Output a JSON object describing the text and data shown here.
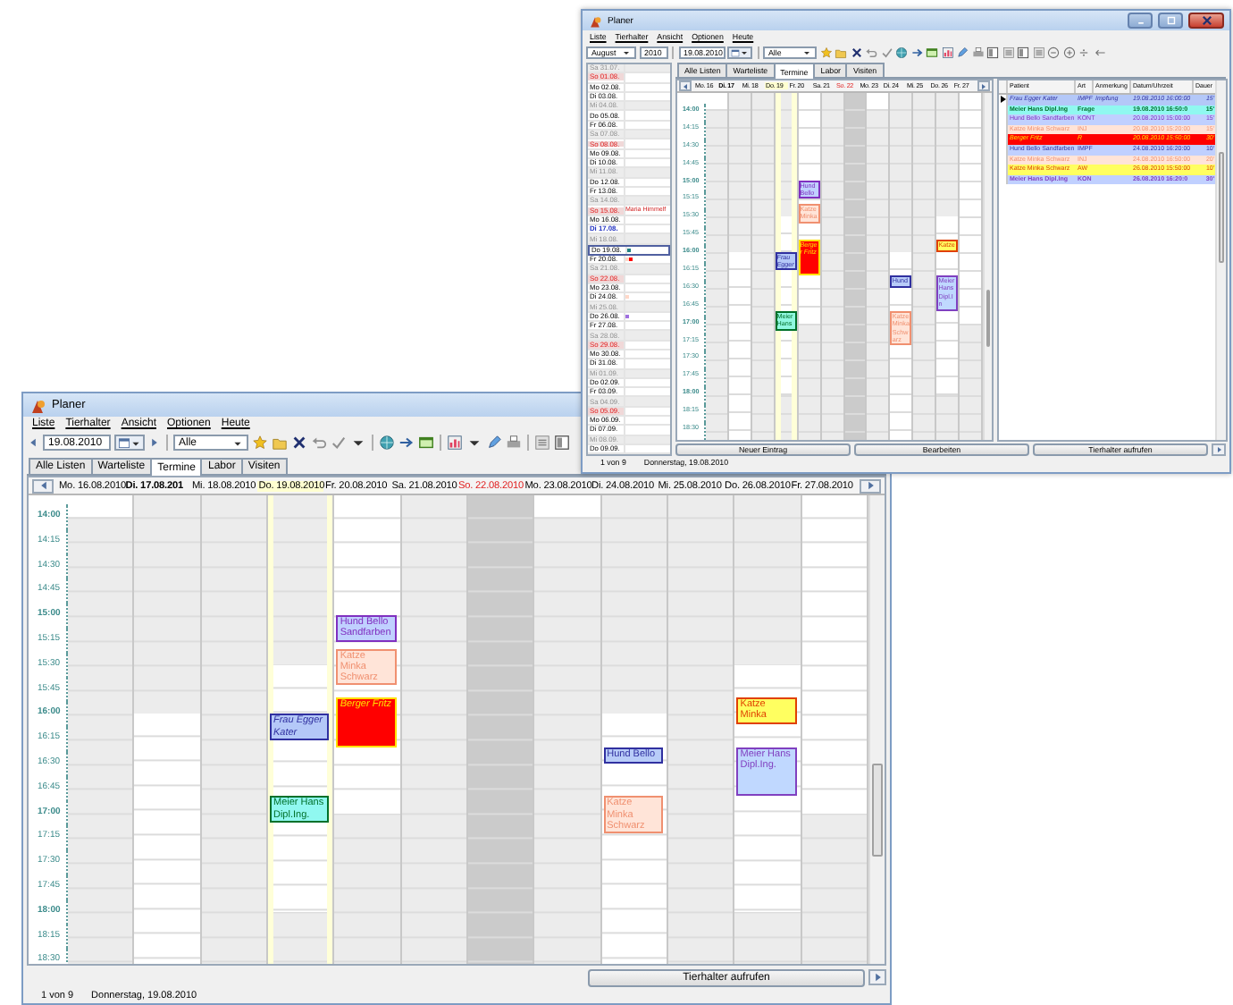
{
  "back_window": {
    "title": "Planer",
    "menu": [
      "Liste",
      "Tierhalter",
      "Ansicht",
      "Optionen",
      "Heute"
    ],
    "toolbar": {
      "month": "August",
      "year": "2010",
      "date": "19.08.2010",
      "filter": "Alle"
    },
    "date_list": [
      {
        "label": "Sa 31.07.",
        "kind": "closed",
        "selected": false
      },
      {
        "label": "So 01.08.",
        "kind": "sunday",
        "selected": false
      },
      {
        "label": "Mo 02.08.",
        "kind": "workday",
        "selected": false
      },
      {
        "label": "Di 03.08.",
        "kind": "workday",
        "selected": false
      },
      {
        "label": "Mi 04.08.",
        "kind": "closed",
        "selected": false
      },
      {
        "label": "Do 05.08.",
        "kind": "workday",
        "selected": false
      },
      {
        "label": "Fr 06.08.",
        "kind": "workday",
        "selected": false
      },
      {
        "label": "Sa 07.08.",
        "kind": "closed",
        "selected": false
      },
      {
        "label": "So 08.08.",
        "kind": "sunday",
        "selected": false
      },
      {
        "label": "Mo 09.08.",
        "kind": "workday",
        "selected": false
      },
      {
        "label": "Di 10.08.",
        "kind": "workday",
        "selected": false
      },
      {
        "label": "Mi 11.08.",
        "kind": "closed",
        "selected": false
      },
      {
        "label": "Do 12.08.",
        "kind": "workday",
        "selected": false
      },
      {
        "label": "Fr 13.08.",
        "kind": "workday",
        "selected": false
      },
      {
        "label": "Sa 14.08.",
        "kind": "closed",
        "selected": false
      },
      {
        "label": "So 15.08.",
        "kind": "sunday",
        "selected": false,
        "note": "Maria Himmelf"
      },
      {
        "label": "Mo 16.08.",
        "kind": "workday",
        "selected": false
      },
      {
        "label": "Di 17.08.",
        "kind": "today",
        "selected": false
      },
      {
        "label": "Mi 18.08.",
        "kind": "closed",
        "selected": false
      },
      {
        "label": "Do 19.08.",
        "kind": "workday",
        "selected": true,
        "marks": [
          {
            "color": "#208080"
          }
        ]
      },
      {
        "label": "Fr 20.08.",
        "kind": "workday",
        "selected": false,
        "marks": [
          {
            "color": "#ffd8c8"
          },
          {
            "color": "#ff0000"
          }
        ]
      },
      {
        "label": "Sa 21.08.",
        "kind": "closed",
        "selected": false
      },
      {
        "label": "So 22.08.",
        "kind": "sunday",
        "selected": false
      },
      {
        "label": "Mo 23.08.",
        "kind": "workday",
        "selected": false
      },
      {
        "label": "Di 24.08.",
        "kind": "workday",
        "selected": false,
        "marks": [
          {
            "color": "#ffd8c8"
          }
        ]
      },
      {
        "label": "Mi 25.08.",
        "kind": "closed",
        "selected": false
      },
      {
        "label": "Do 26.08.",
        "kind": "workday",
        "selected": false,
        "marks": [
          {
            "color": "#a070e0"
          }
        ]
      },
      {
        "label": "Fr 27.08.",
        "kind": "workday",
        "selected": false
      },
      {
        "label": "Sa 28.08.",
        "kind": "closed",
        "selected": false
      },
      {
        "label": "So 29.08.",
        "kind": "sunday",
        "selected": false
      },
      {
        "label": "Mo 30.08.",
        "kind": "workday",
        "selected": false
      },
      {
        "label": "Di 31.08.",
        "kind": "workday",
        "selected": false
      },
      {
        "label": "Mi 01.09.",
        "kind": "closed",
        "selected": false
      },
      {
        "label": "Do 02.09.",
        "kind": "workday",
        "selected": false
      },
      {
        "label": "Fr 03.09.",
        "kind": "workday",
        "selected": false
      },
      {
        "label": "Sa 04.09.",
        "kind": "closed",
        "selected": false
      },
      {
        "label": "So 05.09.",
        "kind": "sunday",
        "selected": false
      },
      {
        "label": "Mo 06.09.",
        "kind": "workday",
        "selected": false
      },
      {
        "label": "Di 07.09.",
        "kind": "workday",
        "selected": false
      },
      {
        "label": "Mi 08.09.",
        "kind": "closed",
        "selected": false
      },
      {
        "label": "Do 09.09.",
        "kind": "workday",
        "selected": false
      }
    ],
    "tabs": [
      {
        "label": "Alle Listen",
        "selected": false
      },
      {
        "label": "Warteliste",
        "selected": false
      },
      {
        "label": "Termine",
        "selected": true
      },
      {
        "label": "Labor",
        "selected": false
      },
      {
        "label": "Visiten",
        "selected": false
      }
    ],
    "calendar": {
      "times": [
        "14:00",
        "14:15",
        "14:30",
        "14:45",
        "15:00",
        "15:15",
        "15:30",
        "15:45",
        "16:00",
        "16:15",
        "16:30",
        "16:45",
        "17:00",
        "17:15",
        "17:30",
        "17:45",
        "18:00",
        "18:15",
        "18:30"
      ],
      "days": [
        {
          "label": "Mo. 16",
          "kind": "open-early",
          "today": false,
          "selected": false
        },
        {
          "label": "Di. 17",
          "kind": "open-late",
          "today": true,
          "selected": false
        },
        {
          "label": "Mi. 18",
          "kind": "closed",
          "today": false,
          "selected": false
        },
        {
          "label": "Do. 19",
          "kind": "open-mid",
          "today": false,
          "selected": true,
          "appointments": [
            {
              "text": "Frau Egger",
              "kind": "impf",
              "color": "#b4c8f8",
              "italic": true,
              "bold": false
            },
            {
              "text": "Meier Hans",
              "kind": "frage",
              "color": "#90f8e0",
              "italic": false,
              "bold": false
            }
          ]
        },
        {
          "label": "Fr. 20",
          "kind": "open-day",
          "today": false,
          "selected": false,
          "appointments": [
            {
              "text": "Hund Bello",
              "kind": "kont",
              "color": "#c0d0ff",
              "italic": false,
              "bold": false
            },
            {
              "text": "Katze Minka",
              "kind": "inj",
              "color": "#ffe4d8",
              "italic": false,
              "bold": false
            },
            {
              "text": "Berger Fritz",
              "kind": "r",
              "color": "#ff0000",
              "italic": true,
              "bold": false
            }
          ]
        },
        {
          "label": "Sa. 21",
          "kind": "closed",
          "today": false,
          "selected": false
        },
        {
          "label": "So. 22",
          "kind": "sunday",
          "today": false,
          "selected": false
        },
        {
          "label": "Mo. 23",
          "kind": "open-early",
          "today": false,
          "selected": false
        },
        {
          "label": "Di. 24",
          "kind": "open-late",
          "today": false,
          "selected": false,
          "appointments": [
            {
              "text": "Hund",
              "kind": "impf",
              "color": "#b8ccf8",
              "italic": false,
              "bold": false
            },
            {
              "text": "Katze Minka Schwarz",
              "kind": "inj",
              "color": "#ffe4d8",
              "italic": false,
              "bold": false
            }
          ]
        },
        {
          "label": "Mi. 25",
          "kind": "closed",
          "today": false,
          "selected": false
        },
        {
          "label": "Do. 26",
          "kind": "open-mid",
          "today": false,
          "selected": false,
          "appointments": [
            {
              "text": "Katze",
              "kind": "aw",
              "color": "#ffff60",
              "italic": false,
              "bold": false
            },
            {
              "text": "Meier Hans Dipl.In",
              "kind": "kon",
              "color": "#c0d8ff",
              "italic": false,
              "bold": false
            }
          ]
        },
        {
          "label": "Fr. 27",
          "kind": "open-day",
          "today": false,
          "selected": false
        }
      ]
    },
    "table": {
      "columns": [
        "Patient",
        "Art",
        "Anmerkung",
        "Datum/Uhrzeit",
        "Dauer"
      ],
      "rows": [
        {
          "selected": true,
          "kind": "impf",
          "color": "#b4c8f8",
          "italic": true,
          "bold": false,
          "patient": "Frau Egger Kater",
          "art": "IMPF",
          "note": "Impfung",
          "datetime": "19.08.2010 16:00:00",
          "duration": "15'"
        },
        {
          "selected": false,
          "kind": "frage",
          "color": "#90f8f0",
          "italic": false,
          "bold": true,
          "patient": "Meier Hans Dipl.Ing",
          "art": "Frage",
          "datetime": "19.08.2010 16:50:0",
          "duration": "15'"
        },
        {
          "selected": false,
          "kind": "kont",
          "color": "#c0d0ff",
          "italic": false,
          "bold": false,
          "patient": "Hund Bello Sandfarben",
          "art": "KONT",
          "datetime": "20.08.2010 15:00:00",
          "duration": "15'"
        },
        {
          "selected": false,
          "kind": "inj",
          "color": "#ffe4d8",
          "italic": false,
          "bold": false,
          "patient": "Katze Minka Schwarz",
          "art": "INJ",
          "datetime": "20.08.2010 15:20:00",
          "duration": "15'"
        },
        {
          "selected": false,
          "kind": "r",
          "color": "#ff0000",
          "italic": true,
          "bold": false,
          "patient": "Berger Fritz",
          "art": "R",
          "datetime": "20.08.2010 15:50:00",
          "duration": "30'"
        },
        {
          "selected": false,
          "kind": "impf",
          "color": "#c0d0ff",
          "italic": false,
          "bold": false,
          "patient": "Hund Bello Sandfarben",
          "art": "IMPF",
          "datetime": "24.08.2010 16:20:00",
          "duration": "10'"
        },
        {
          "selected": false,
          "kind": "inj",
          "color": "#ffe4d8",
          "italic": false,
          "bold": false,
          "patient": "Katze Minka Schwarz",
          "art": "INJ",
          "datetime": "24.08.2010 16:50:00",
          "duration": "20'"
        },
        {
          "selected": false,
          "kind": "aw",
          "color": "#ffff60",
          "italic": false,
          "bold": false,
          "patient": "Katze Minka Schwarz",
          "art": "AW",
          "datetime": "26.08.2010 15:50:00",
          "duration": "10'"
        },
        {
          "selected": false,
          "kind": "kon",
          "color": "#c0d0ff",
          "italic": false,
          "bold": true,
          "patient": "Meier Hans Dipl.Ing",
          "art": "KON",
          "datetime": "26.08.2010 16:20:0",
          "duration": "30'"
        }
      ]
    },
    "buttons": [
      "Neuer Eintrag",
      "Bearbeiten",
      "Tierhalter aufrufen"
    ],
    "status": {
      "count": "1 von 9",
      "date": "Donnerstag, 19.08.2010"
    }
  },
  "front_window": {
    "title": "Planer",
    "menu": [
      "Liste",
      "Tierhalter",
      "Ansicht",
      "Optionen",
      "Heute"
    ],
    "toolbar": {
      "date": "19.08.2010",
      "filter": "Alle"
    },
    "tabs": [
      {
        "label": "Alle Listen",
        "selected": false
      },
      {
        "label": "Warteliste",
        "selected": false
      },
      {
        "label": "Termine",
        "selected": true
      },
      {
        "label": "Labor",
        "selected": false
      },
      {
        "label": "Visiten",
        "selected": false
      }
    ],
    "calendar": {
      "times": [
        "14:00",
        "14:15",
        "14:30",
        "14:45",
        "15:00",
        "15:15",
        "15:30",
        "15:45",
        "16:00",
        "16:15",
        "16:30",
        "16:45",
        "17:00",
        "17:15",
        "17:30",
        "17:45",
        "18:00",
        "18:15",
        "18:30"
      ],
      "days": [
        {
          "label": "Mo. 16.08.2010",
          "kind": "open-early",
          "today": false,
          "selected": false
        },
        {
          "label": "Di. 17.08.201",
          "kind": "open-late",
          "today": true,
          "selected": false
        },
        {
          "label": "Mi. 18.08.2010",
          "kind": "closed",
          "today": false,
          "selected": false
        },
        {
          "label": "Do. 19.08.2010",
          "kind": "open-mid",
          "today": false,
          "selected": true,
          "appointments": [
            {
              "text": "Frau Egger Kater",
              "kind": "impf",
              "color": "#b4c8f8",
              "italic": true,
              "bold": false
            },
            {
              "text": "Meier Hans Dipl.Ing.",
              "kind": "frage",
              "color": "#90f8f0",
              "italic": false,
              "bold": false
            }
          ]
        },
        {
          "label": "Fr. 20.08.2010",
          "kind": "open-day",
          "today": false,
          "selected": false,
          "appointments": [
            {
              "text": "Hund Bello Sandfarben",
              "kind": "kont",
              "color": "#c0d0ff",
              "italic": false,
              "bold": false
            },
            {
              "text": "Katze Minka Schwarz",
              "kind": "inj",
              "color": "#ffe4d8",
              "italic": false,
              "bold": false
            },
            {
              "text": "Berger Fritz",
              "kind": "r",
              "color": "#ff0000",
              "italic": true,
              "bold": false
            }
          ]
        },
        {
          "label": "Sa. 21.08.2010",
          "kind": "closed",
          "today": false,
          "selected": false
        },
        {
          "label": "So. 22.08.2010",
          "kind": "sunday",
          "today": false,
          "selected": false
        },
        {
          "label": "Mo. 23.08.2010",
          "kind": "open-early",
          "today": false,
          "selected": false
        },
        {
          "label": "Di. 24.08.2010",
          "kind": "open-late",
          "today": false,
          "selected": false,
          "appointments": [
            {
              "text": "Hund Bello",
              "kind": "impf",
              "color": "#b8ccf8",
              "italic": false,
              "bold": false
            },
            {
              "text": "Katze Minka Schwarz",
              "kind": "inj",
              "color": "#ffe4d8",
              "italic": false,
              "bold": false
            }
          ]
        },
        {
          "label": "Mi. 25.08.2010",
          "kind": "closed",
          "today": false,
          "selected": false
        },
        {
          "label": "Do. 26.08.2010",
          "kind": "open-mid",
          "today": false,
          "selected": false,
          "appointments": [
            {
              "text": "Katze Minka",
              "kind": "aw",
              "color": "#ffff60",
              "italic": false,
              "bold": false
            },
            {
              "text": "Meier Hans Dipl.Ing.",
              "kind": "kon",
              "color": "#c0d8ff",
              "italic": false,
              "bold": false
            }
          ]
        },
        {
          "label": "Fr. 27.08.2010",
          "kind": "open-day",
          "today": false,
          "selected": false
        }
      ]
    },
    "buttons": [
      "Tierhalter aufrufen"
    ],
    "status": {
      "count": "1 von 9",
      "date": "Donnerstag, 19.08.2010"
    }
  }
}
